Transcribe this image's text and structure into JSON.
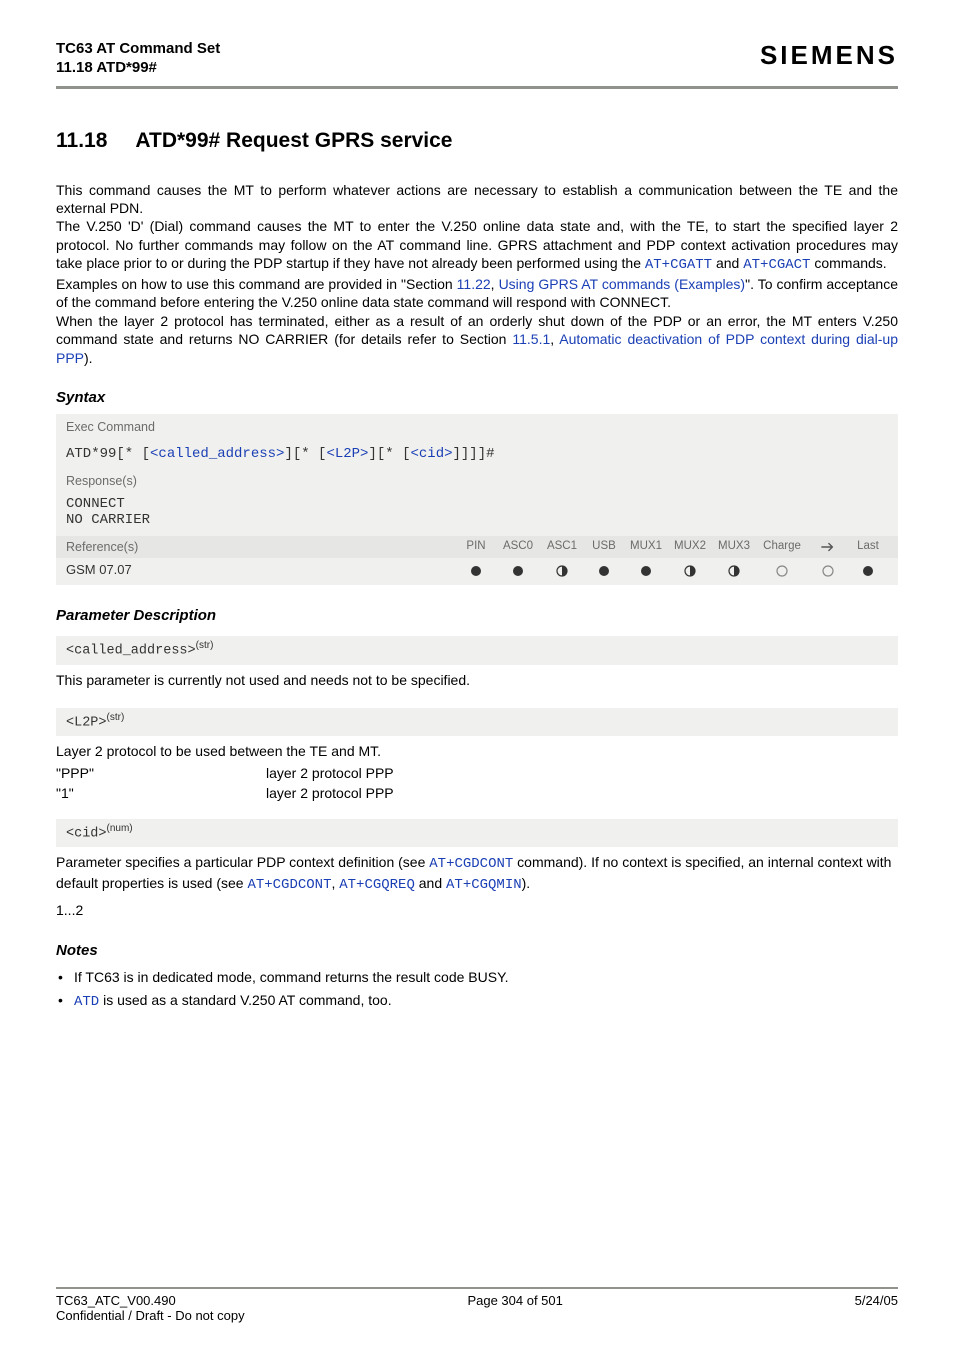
{
  "header": {
    "doc_title": "TC63 AT Command Set",
    "section_ref": "11.18 ATD*99#",
    "brand": "SIEMENS"
  },
  "section": {
    "number": "11.18",
    "heading": "ATD*99#   Request GPRS service"
  },
  "body": {
    "p1": "This command causes the MT to perform whatever actions are necessary to establish a communication between the TE and the external PDN.",
    "p2a": "The V.250 'D' (Dial) command causes the MT to enter the V.250 online data state and, with the TE, to start the specified layer 2 protocol. No further commands may follow on the AT command line. GPRS attachment and PDP context activation procedures may take place prior to or during the PDP startup if they have not already been performed using the ",
    "cgatt": "AT+CGATT",
    "and": " and ",
    "cgact": "AT+CGACT",
    "p2b": " commands.",
    "p3a": "Examples on how to use this command are provided in \"Section ",
    "sec1122": "11.22",
    "comma": ", ",
    "sec1122t": "Using GPRS AT commands (Examples)",
    "p3b": "\". To confirm acceptance of the command before entering the V.250 online data state command will respond with CONNECT.",
    "p4a": "When the layer 2 protocol has terminated, either as a result of an orderly shut down of the PDP or an error, the MT enters V.250 command state and returns NO CARRIER (for details refer to Section ",
    "sec1151": "11.5.1",
    "sec1151t": "Automatic deactivation of PDP context during dial-up PPP",
    "p4b": ")."
  },
  "syntax": {
    "label": "Syntax",
    "exec_label": "Exec Command",
    "exec_prefix": "ATD*99[* [",
    "exec_called": "<called_address>",
    "exec_mid1": "][* [",
    "exec_l2p": "<L2P>",
    "exec_mid2": "][* [",
    "exec_cid": "<cid>",
    "exec_suffix": "]]]]#",
    "response_label": "Response(s)",
    "resp1": "CONNECT",
    "resp2": "NO CARRIER",
    "ref_label": "Reference(s)",
    "ref_cols": [
      "PIN",
      "ASC0",
      "ASC1",
      "USB",
      "MUX1",
      "MUX2",
      "MUX3",
      "Charge",
      "✈",
      "Last"
    ],
    "ref_row": "GSM 07.07",
    "ref_dots": [
      "full",
      "full",
      "half",
      "full",
      "full",
      "half",
      "half",
      "empty",
      "empty",
      "full"
    ]
  },
  "params": {
    "label": "Parameter Description",
    "p1": {
      "name": "<called_address>",
      "type": "(str)",
      "desc": "This parameter is currently not used and needs not to be specified."
    },
    "p2": {
      "name": "<L2P>",
      "type": "(str)",
      "desc": "Layer 2 protocol to be used between the TE and MT.",
      "rows": [
        {
          "k": "\"PPP\"",
          "v": "layer 2 protocol PPP"
        },
        {
          "k": "\"1\"",
          "v": "layer 2 protocol PPP"
        }
      ]
    },
    "p3": {
      "name": "<cid>",
      "type": "(num)",
      "desc_a": "Parameter specifies a particular PDP context definition (see ",
      "l1": "AT+CGDCONT",
      "desc_b": " command). If no context is specified, an internal context with default properties is used (see ",
      "l2": "AT+CGDCONT",
      "comma": ", ",
      "l3": "AT+CGQREQ",
      "and": " and ",
      "l4": "AT+CGQMIN",
      "desc_c": ").",
      "range": "1...2"
    }
  },
  "notes": {
    "label": "Notes",
    "n1": "If TC63 is in dedicated mode, command returns the result code BUSY.",
    "n2a": "ATD",
    "n2b": " is used as a standard V.250 AT command, too."
  },
  "footer": {
    "left": "TC63_ATC_V00.490",
    "center": "Page 304 of 501",
    "right": "5/24/05",
    "left2": "Confidential / Draft - Do not copy"
  }
}
